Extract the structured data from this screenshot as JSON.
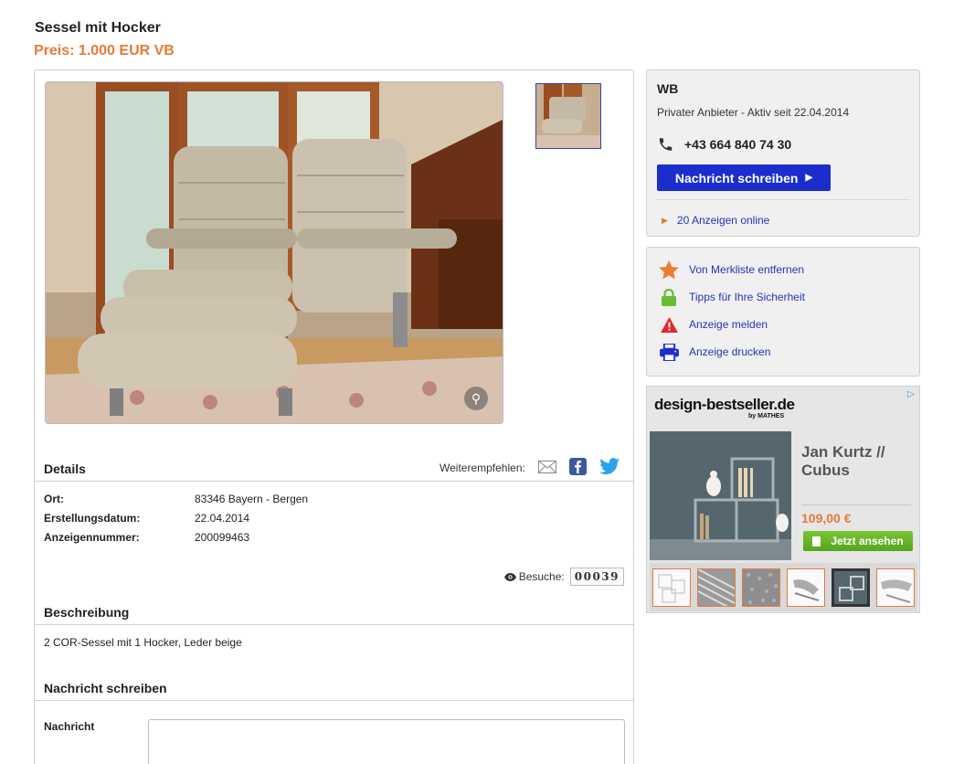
{
  "listing": {
    "title": "Sessel mit Hocker",
    "price": "Preis: 1.000 EUR VB"
  },
  "details": {
    "heading": "Details",
    "share_label": "Weiterempfehlen:",
    "rows": [
      {
        "label": "Ort:",
        "value": "83346 Bayern - Bergen"
      },
      {
        "label": "Erstellungsdatum:",
        "value": "22.04.2014"
      },
      {
        "label": "Anzeigennummer:",
        "value": "200099463"
      }
    ],
    "visits_label": "Besuche:",
    "visits_count": "00039"
  },
  "description": {
    "heading": "Beschreibung",
    "text": "2 COR-Sessel mit 1 Hocker, Leder beige"
  },
  "message": {
    "heading": "Nachricht schreiben",
    "field_label": "Nachricht",
    "field_value": ""
  },
  "seller": {
    "name": "WB",
    "info": "Privater Anbieter - Aktiv seit 22.04.2014",
    "phone": "+43 664 840 74 30",
    "button_label": "Nachricht schreiben",
    "ads_online": "20 Anzeigen online"
  },
  "actions": [
    {
      "label": "Von Merkliste entfernen",
      "icon": "star-icon"
    },
    {
      "label": "Tipps für Ihre Sicherheit",
      "icon": "lock-icon"
    },
    {
      "label": "Anzeige melden",
      "icon": "warning-icon"
    },
    {
      "label": "Anzeige drucken",
      "icon": "printer-icon"
    }
  ],
  "ad": {
    "logo": "design-bestseller.de",
    "logo_sub": "by MATHES",
    "product": "Jan Kurtz // Cubus",
    "product_line1": "Jan Kurtz //",
    "product_line2": "Cubus",
    "price": "109,00 €",
    "cta": "Jetzt ansehen"
  },
  "colors": {
    "accent_orange": "#e77a35",
    "button_blue": "#1b2ecd",
    "link_blue": "#2535b6",
    "panel_bg": "#f0f0f0",
    "cta_green": "#6cb82a"
  }
}
